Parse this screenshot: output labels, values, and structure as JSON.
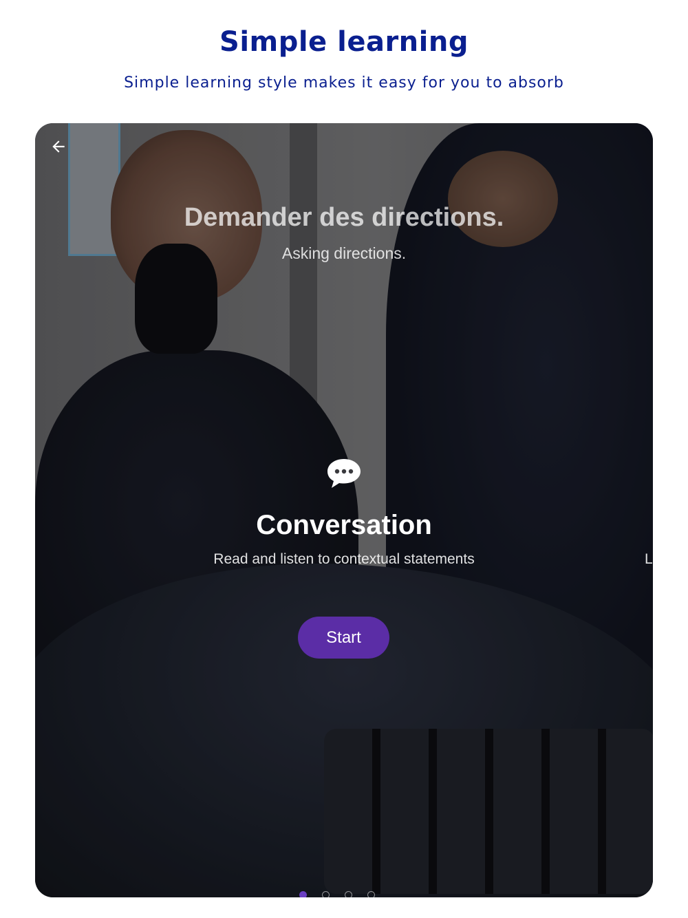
{
  "header": {
    "title": "Simple learning",
    "subtitle": "Simple learning style makes it easy for you to absorb"
  },
  "lesson": {
    "title": "Demander des directions.",
    "translation": "Asking directions."
  },
  "card": {
    "icon": "chat-bubble-icon",
    "title": "Conversation",
    "description": "Read and listen to contextual statements",
    "next_peek": "L"
  },
  "actions": {
    "start_label": "Start"
  },
  "pagination": {
    "total": 4,
    "active_index": 0
  },
  "colors": {
    "brand_navy": "#0a1f8f",
    "accent_purple": "#5b2da6"
  }
}
